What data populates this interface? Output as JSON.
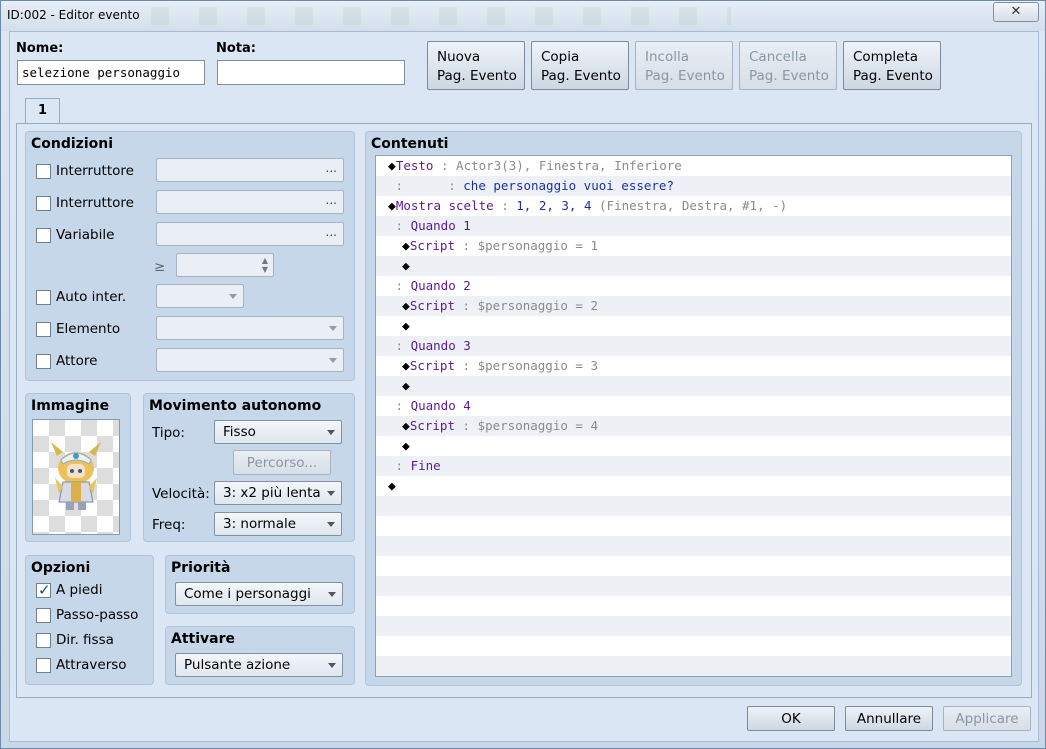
{
  "window": {
    "title": "ID:002 - Editor evento",
    "close_glyph": "✕"
  },
  "header": {
    "name_label": "Nome:",
    "name_value": "selezione personaggio",
    "note_label": "Nota:",
    "note_value": "",
    "buttons": [
      {
        "line1": "Nuova",
        "line2": "Pag. Evento",
        "enabled": true
      },
      {
        "line1": "Copia",
        "line2": "Pag. Evento",
        "enabled": true
      },
      {
        "line1": "Incolla",
        "line2": "Pag. Evento",
        "enabled": false
      },
      {
        "line1": "Cancella",
        "line2": "Pag. Evento",
        "enabled": false
      },
      {
        "line1": "Completa",
        "line2": "Pag. Evento",
        "enabled": true
      }
    ]
  },
  "tabs": [
    {
      "label": "1"
    }
  ],
  "conditions": {
    "title": "Condizioni",
    "items": [
      {
        "label": "Interruttore",
        "checked": false,
        "value": "..."
      },
      {
        "label": "Interruttore",
        "checked": false,
        "value": "..."
      },
      {
        "label": "Variabile",
        "checked": false,
        "value": "..."
      },
      {
        "label": "Auto inter.",
        "checked": false,
        "value": ""
      },
      {
        "label": "Elemento",
        "checked": false,
        "value": ""
      },
      {
        "label": "Attore",
        "checked": false,
        "value": ""
      }
    ],
    "compare_symbol": "≥",
    "number_value": ""
  },
  "image": {
    "title": "Immagine",
    "icon": "character-sprite-icon"
  },
  "autonomous": {
    "title": "Movimento autonomo",
    "type_label": "Tipo:",
    "type_value": "Fisso",
    "route_button": "Percorso...",
    "speed_label": "Velocità:",
    "speed_value": "3: x2 più lenta",
    "freq_label": "Freq:",
    "freq_value": "3: normale"
  },
  "options": {
    "title": "Opzioni",
    "items": [
      {
        "label": "A piedi",
        "checked": true
      },
      {
        "label": "Passo-passo",
        "checked": false
      },
      {
        "label": "Dir. fissa",
        "checked": false
      },
      {
        "label": "Attraverso",
        "checked": false
      }
    ]
  },
  "priority": {
    "title": "Priorità",
    "value": "Come i personaggi"
  },
  "trigger": {
    "title": "Attivare",
    "value": "Pulsante azione"
  },
  "contents": {
    "title": "Contenuti",
    "rows": [
      {
        "indent": 0,
        "parts": [
          [
            "◆",
            "dia"
          ],
          [
            "Testo",
            "k"
          ],
          [
            " : ",
            "g"
          ],
          [
            "Actor3(3), Finestra, Inferiore",
            "g"
          ]
        ]
      },
      {
        "indent": 0,
        "parts": [
          [
            " : ",
            "g"
          ],
          [
            "     : ",
            "g"
          ],
          [
            "che personaggio vuoi essere?",
            "b"
          ]
        ]
      },
      {
        "indent": 0,
        "parts": [
          [
            "◆",
            "dia"
          ],
          [
            "Mostra scelte",
            "k"
          ],
          [
            " : ",
            "g"
          ],
          [
            "1, 2, 3, 4",
            "b"
          ],
          [
            " (Finestra, Destra, #1, -)",
            "g"
          ]
        ]
      },
      {
        "indent": 0,
        "parts": [
          [
            " : ",
            "g"
          ],
          [
            "Quando 1",
            "k"
          ]
        ]
      },
      {
        "indent": 1,
        "parts": [
          [
            "◆",
            "dia"
          ],
          [
            "Script",
            "k"
          ],
          [
            " : ",
            "g"
          ],
          [
            "$personaggio = 1",
            "g"
          ]
        ]
      },
      {
        "indent": 1,
        "parts": [
          [
            "◆",
            "dia"
          ]
        ]
      },
      {
        "indent": 0,
        "parts": [
          [
            " : ",
            "g"
          ],
          [
            "Quando 2",
            "k"
          ]
        ]
      },
      {
        "indent": 1,
        "parts": [
          [
            "◆",
            "dia"
          ],
          [
            "Script",
            "k"
          ],
          [
            " : ",
            "g"
          ],
          [
            "$personaggio = 2",
            "g"
          ]
        ]
      },
      {
        "indent": 1,
        "parts": [
          [
            "◆",
            "dia"
          ]
        ]
      },
      {
        "indent": 0,
        "parts": [
          [
            " : ",
            "g"
          ],
          [
            "Quando 3",
            "k"
          ]
        ]
      },
      {
        "indent": 1,
        "parts": [
          [
            "◆",
            "dia"
          ],
          [
            "Script",
            "k"
          ],
          [
            " : ",
            "g"
          ],
          [
            "$personaggio = 3",
            "g"
          ]
        ]
      },
      {
        "indent": 1,
        "parts": [
          [
            "◆",
            "dia"
          ]
        ]
      },
      {
        "indent": 0,
        "parts": [
          [
            " : ",
            "g"
          ],
          [
            "Quando 4",
            "k"
          ]
        ]
      },
      {
        "indent": 1,
        "parts": [
          [
            "◆",
            "dia"
          ],
          [
            "Script",
            "k"
          ],
          [
            " : ",
            "g"
          ],
          [
            "$personaggio = 4",
            "g"
          ]
        ]
      },
      {
        "indent": 1,
        "parts": [
          [
            "◆",
            "dia"
          ]
        ]
      },
      {
        "indent": 0,
        "parts": [
          [
            " : ",
            "g"
          ],
          [
            "Fine",
            "k"
          ]
        ]
      },
      {
        "indent": 0,
        "parts": [
          [
            "◆",
            "dia"
          ]
        ]
      }
    ],
    "empty_rows": 9
  },
  "footer": {
    "ok": "OK",
    "cancel": "Annullare",
    "apply": "Applicare"
  },
  "colors": {
    "command": "#5b1a91",
    "param": "#8a8a8a",
    "text": "#1c2fa8",
    "panel": "#c7d7ea"
  }
}
